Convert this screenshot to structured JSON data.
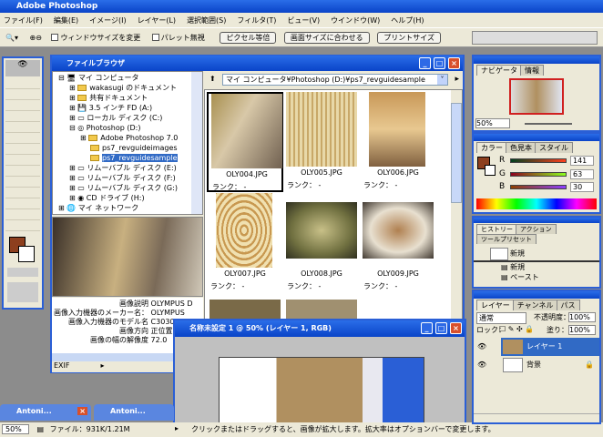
{
  "app": {
    "title": "Adobe Photoshop"
  },
  "menu": [
    "ファイル(F)",
    "編集(E)",
    "イメージ(I)",
    "レイヤー(L)",
    "選択範囲(S)",
    "フィルタ(T)",
    "ビュー(V)",
    "ウインドウ(W)",
    "ヘルプ(H)"
  ],
  "options": {
    "resize_windows": "ウィンドウサイズを変更",
    "ignore_palettes": "パレット無視",
    "actual_pixels": "ピクセル等倍",
    "fit_screen": "画面サイズに合わせる",
    "print_size": "プリントサイズ"
  },
  "file_browser": {
    "title": "ファイルブラウザ",
    "path": "マイ コンピュータ¥Photoshop (D:)¥ps7_revguidesample",
    "tree": [
      "マイ コンピュータ",
      "wakasugi のドキュメント",
      "共有ドキュメント",
      "3.5 インチ FD (A:)",
      "ローカル ディスク (C:)",
      "Photoshop (D:)",
      "Adobe Photoshop 7.0",
      "ps7_revguideimages",
      "ps7_revguidesample",
      "リムーバブル ディスク (E:)",
      "リムーバブル ディスク (F:)",
      "リムーバブル ディスク (G:)",
      "CD ドライブ (H:)",
      "マイ ネットワーク"
    ],
    "metadata": [
      {
        "label": "画像説明",
        "value": "OLYMPUS D"
      },
      {
        "label": "画像入力機器のメーカー名：",
        "value": "OLYMPUS"
      },
      {
        "label": "画像入力機器のモデル名",
        "value": "C3030"
      },
      {
        "label": "画像方向",
        "value": "正位置"
      },
      {
        "label": "画像の幅の解像度",
        "value": "72.0"
      }
    ],
    "metadata_mode": "EXIF",
    "thumbnails": [
      {
        "name": "OLY004.JPG",
        "rank": "ランク： -",
        "color": "#8a7a5a"
      },
      {
        "name": "OLY005.JPG",
        "rank": "ランク： -",
        "color": "#d8c08a"
      },
      {
        "name": "OLY006.JPG",
        "rank": "ランク： -",
        "color": "#b08850"
      },
      {
        "name": "OLY007.JPG",
        "rank": "ランク： -",
        "color": "#c8a060"
      },
      {
        "name": "OLY008.JPG",
        "rank": "ランク： -",
        "color": "#8a8050"
      },
      {
        "name": "OLY009.JPG",
        "rank": "ランク： -",
        "color": "#a07040"
      }
    ]
  },
  "document": {
    "title": "名称未設定 1 @ 50% (レイヤー 1, RGB)"
  },
  "minimized": [
    "Antoni...",
    "Antoni..."
  ],
  "status": {
    "zoom": "50%",
    "file": "ファイル：931K/1.21M",
    "hint": "クリックまたはドラッグすると、画像が拡大します。拡大率はオプションバーで変更します。"
  },
  "navigator": {
    "tabs": [
      "ナビゲータ",
      "情報"
    ],
    "zoom": "50%"
  },
  "color": {
    "tabs": [
      "カラー",
      "色見本",
      "スタイル"
    ],
    "r_label": "R",
    "g_label": "G",
    "b_label": "B",
    "r": "141",
    "g": "63",
    "b": "30",
    "foreground": "#8d3f1e"
  },
  "history": {
    "tabs": [
      "ヒストリー",
      "アクション",
      "ツールプリセット"
    ],
    "snapshot": "新規",
    "items": [
      "新規",
      "ペースト"
    ]
  },
  "layers": {
    "tabs": [
      "レイヤー",
      "チャンネル",
      "パス"
    ],
    "blend": "通常",
    "opacity_label": "不透明度：",
    "opacity": "100%",
    "lock_label": "ロック：",
    "fill_label": "塗り：",
    "fill": "100%",
    "items": [
      "レイヤー 1",
      "背景"
    ]
  }
}
